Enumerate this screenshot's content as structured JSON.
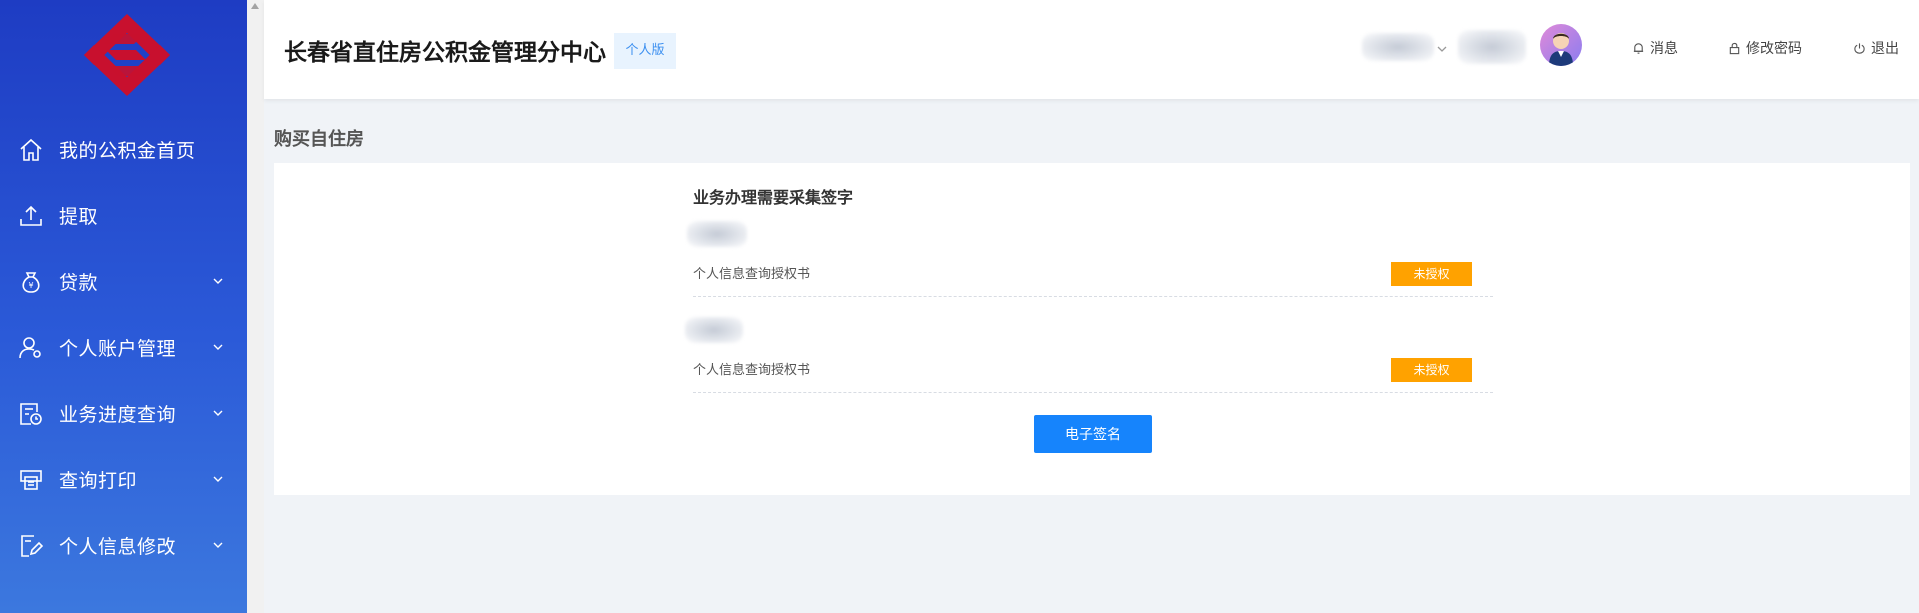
{
  "sidebar": {
    "items": [
      {
        "label": "我的公积金首页",
        "icon": "home-icon",
        "has_submenu": false
      },
      {
        "label": "提取",
        "icon": "upload-icon",
        "has_submenu": false
      },
      {
        "label": "贷款",
        "icon": "money-bag-icon",
        "has_submenu": true
      },
      {
        "label": "个人账户管理",
        "icon": "user-settings-icon",
        "has_submenu": true
      },
      {
        "label": "业务进度查询",
        "icon": "progress-clock-icon",
        "has_submenu": true
      },
      {
        "label": "查询打印",
        "icon": "printer-icon",
        "has_submenu": true
      },
      {
        "label": "个人信息修改",
        "icon": "edit-document-icon",
        "has_submenu": true
      }
    ]
  },
  "header": {
    "title": "长春省直住房公积金管理分中心",
    "edition_badge": "个人版",
    "actions": {
      "messages": "消息",
      "change_password": "修改密码",
      "logout": "退出"
    }
  },
  "main": {
    "heading": "购买自住房",
    "card": {
      "title": "业务办理需要采集签字",
      "rows": [
        {
          "document": "个人信息查询授权书",
          "status": "未授权"
        },
        {
          "document": "个人信息查询授权书",
          "status": "未授权"
        }
      ],
      "esign_button": "电子签名"
    }
  },
  "colors": {
    "sidebar_top": "#1e3cc3",
    "sidebar_bottom": "#3c78de",
    "logo_red": "#c8102e",
    "status_orange": "#ffa200",
    "primary_blue": "#1684fc",
    "badge_bg": "#e8f3fe",
    "badge_text": "#3b8ff0"
  }
}
